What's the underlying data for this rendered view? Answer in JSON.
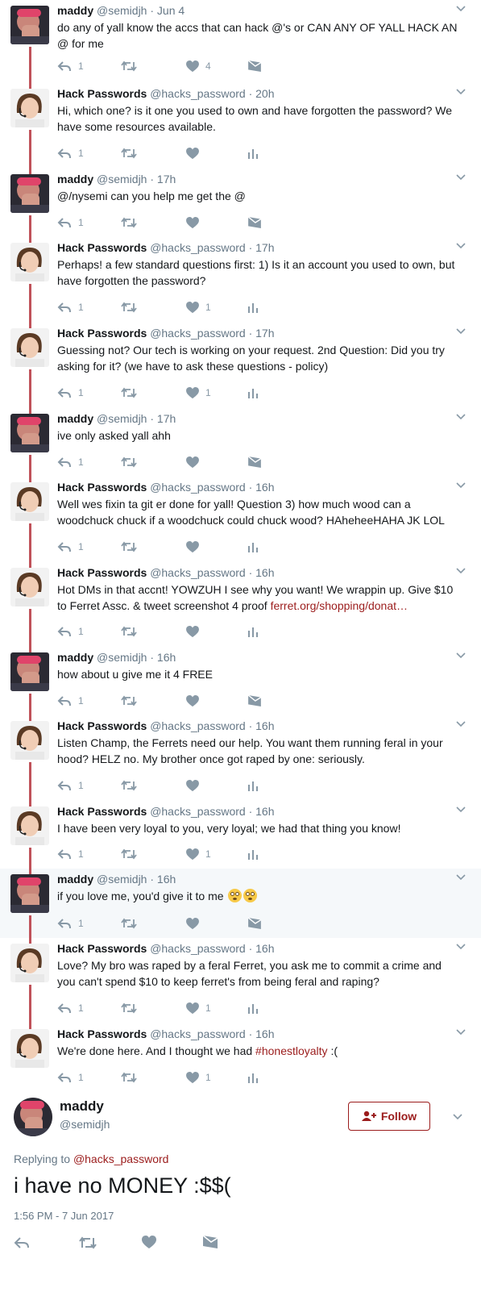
{
  "thread": [
    {
      "name": "maddy",
      "handle": "@semidjh",
      "time": "· Jun 4",
      "text": "do any of yall know the accs that can hack @'s or CAN ANY OF YALL HACK AN @ for me",
      "reply_count": "1",
      "like_count": "4",
      "avatar": "maddy",
      "last_action": "dm"
    },
    {
      "name": "Hack Passwords",
      "handle": "@hacks_password",
      "time": "· 20h",
      "text": "Hi, which one? is it one you used to own and have forgotten the password? We have some resources available.",
      "reply_count": "1",
      "like_count": "",
      "avatar": "hack",
      "last_action": "analytics"
    },
    {
      "name": "maddy",
      "handle": "@semidjh",
      "time": "· 17h",
      "text": "@/nysemi can you help me get the @",
      "reply_count": "1",
      "like_count": "",
      "avatar": "maddy",
      "last_action": "dm"
    },
    {
      "name": "Hack Passwords",
      "handle": "@hacks_password",
      "time": "· 17h",
      "text": "Perhaps! a few standard questions first: 1) Is it an account you used to own, but have forgotten the password?",
      "reply_count": "1",
      "like_count": "1",
      "avatar": "hack",
      "last_action": "analytics"
    },
    {
      "name": "Hack Passwords",
      "handle": "@hacks_password",
      "time": "· 17h",
      "text": "Guessing not? Our tech is working on your request. 2nd Question: Did you try asking for it? (we have to ask these questions - policy)",
      "reply_count": "1",
      "like_count": "1",
      "avatar": "hack",
      "last_action": "analytics"
    },
    {
      "name": "maddy",
      "handle": "@semidjh",
      "time": "· 17h",
      "text": "ive only asked yall ahh",
      "reply_count": "1",
      "like_count": "",
      "avatar": "maddy",
      "last_action": "dm"
    },
    {
      "name": "Hack Passwords",
      "handle": "@hacks_password",
      "time": "· 16h",
      "text": "Well wes fixin ta git er done for yall! Question 3) how much wood can a woodchuck chuck if a woodchuck could chuck wood? HAheheeHAHA JK LOL",
      "reply_count": "1",
      "like_count": "",
      "avatar": "hack",
      "last_action": "analytics"
    },
    {
      "name": "Hack Passwords",
      "handle": "@hacks_password",
      "time": "· 16h",
      "text": "Hot DMs in that accnt! YOWZUH I see why you want! We wrappin up. Give $10 to Ferret Assc. & tweet screenshot 4 proof ",
      "link": "ferret.org/shopping/donat…",
      "reply_count": "1",
      "like_count": "",
      "avatar": "hack",
      "last_action": "analytics"
    },
    {
      "name": "maddy",
      "handle": "@semidjh",
      "time": "· 16h",
      "text": "how about u give me it 4 FREE",
      "reply_count": "1",
      "like_count": "",
      "avatar": "maddy",
      "last_action": "dm"
    },
    {
      "name": "Hack Passwords",
      "handle": "@hacks_password",
      "time": "· 16h",
      "text": "Listen Champ, the Ferrets need our help. You want them running feral in  your hood? HELZ no. My brother once got raped by one: seriously.",
      "reply_count": "1",
      "like_count": "",
      "avatar": "hack",
      "last_action": "analytics"
    },
    {
      "name": "Hack Passwords",
      "handle": "@hacks_password",
      "time": "· 16h",
      "text": "I have been very loyal to you, very loyal; we had that thing you know!",
      "reply_count": "1",
      "like_count": "1",
      "avatar": "hack",
      "last_action": "analytics"
    },
    {
      "name": "maddy",
      "handle": "@semidjh",
      "time": "· 16h",
      "text": "if you love me, you'd give it to me ",
      "emoji": "flushed-face-icon",
      "reply_count": "1",
      "like_count": "",
      "avatar": "maddy",
      "last_action": "dm",
      "highlight": true
    },
    {
      "name": "Hack Passwords",
      "handle": "@hacks_password",
      "time": "· 16h",
      "text": "Love? My bro was raped by a feral Ferret, you ask me to commit a crime and you can't spend $10 to keep ferret's from being feral and raping?",
      "reply_count": "1",
      "like_count": "1",
      "avatar": "hack",
      "last_action": "analytics"
    },
    {
      "name": "Hack Passwords",
      "handle": "@hacks_password",
      "time": "· 16h",
      "text": "We're done here. And I thought we had ",
      "hashtag": "#honestloyalty",
      "text_after": " :(",
      "reply_count": "1",
      "like_count": "1",
      "avatar": "hack",
      "last_action": "analytics"
    }
  ],
  "main_tweet": {
    "name": "maddy",
    "handle": "@semidjh",
    "follow_label": "Follow",
    "replying_label": "Replying to",
    "replying_handle": "@hacks_password",
    "text": "i have no MONEY :$$(",
    "timestamp": "1:56 PM - 7 Jun 2017"
  },
  "colors": {
    "accent": "#9b1c1c",
    "thread_line": "#c0525a",
    "muted": "#8899a6",
    "highlight_bg": "#f5f8fa"
  }
}
